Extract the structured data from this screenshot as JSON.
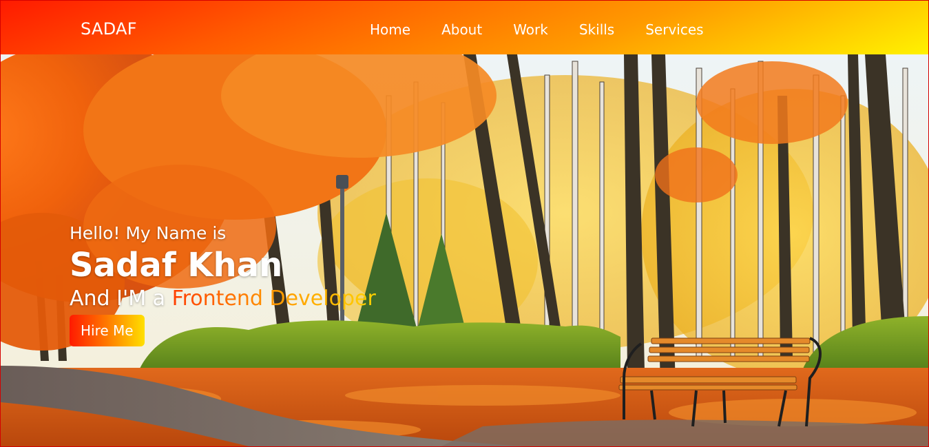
{
  "brand": {
    "logo_text": "SADAF"
  },
  "nav": {
    "items": [
      {
        "label": "Home"
      },
      {
        "label": "About"
      },
      {
        "label": "Work"
      },
      {
        "label": "Skills"
      },
      {
        "label": "Services"
      }
    ]
  },
  "hero": {
    "greeting": "Hello! My Name is",
    "name": "Sadaf Khan",
    "role_prefix": "And I'M a ",
    "role_highlight": "Frontend Developer",
    "cta_label": "Hire Me",
    "background": "autumn-park-photo"
  },
  "colors": {
    "nav_gradient_start": "#ff1a00",
    "nav_gradient_end": "#fff200",
    "accent_orange": "#ff7a00",
    "text_white": "#ffffff",
    "border_red": "#d40000"
  }
}
